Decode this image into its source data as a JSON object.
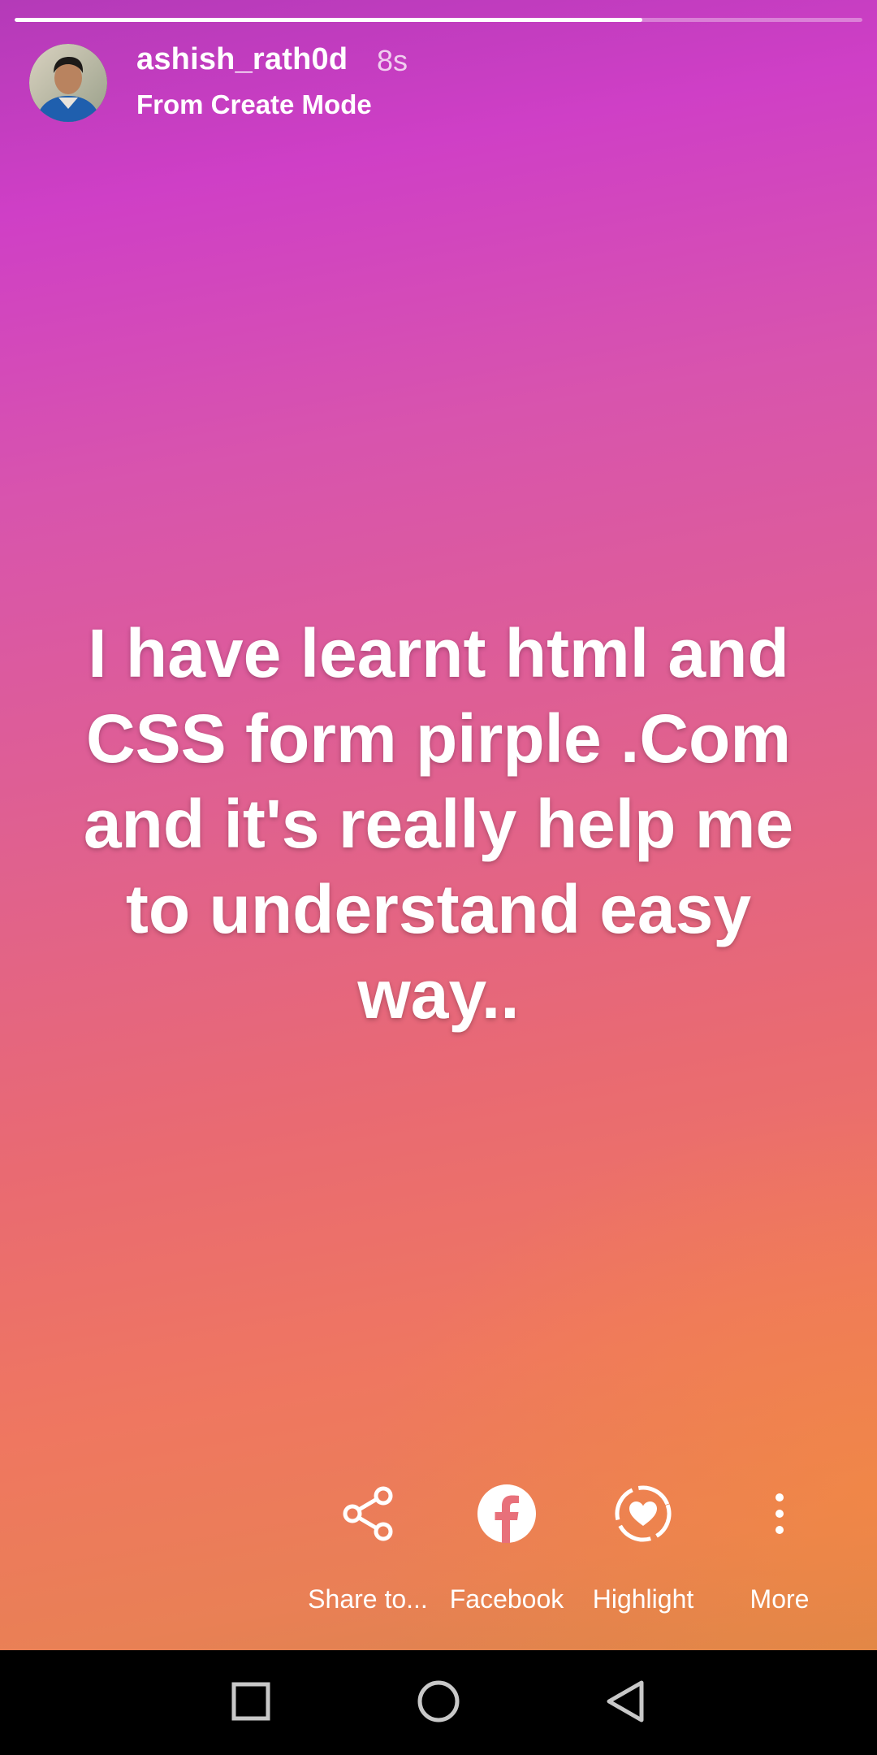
{
  "story": {
    "progress": 0.74,
    "username": "ashish_rath0d",
    "timestamp": "8s",
    "subtitle": "From Create Mode",
    "text": "I have learnt html and CSS form pirple .Com and it's really help me to understand easy way.."
  },
  "actions": {
    "share_label": "Share to...",
    "facebook_label": "Facebook",
    "highlight_label": "Highlight",
    "more_label": "More"
  },
  "icons": {
    "share": "share-icon",
    "facebook": "facebook-icon",
    "highlight": "highlight-heart-icon",
    "more": "more-vertical-icon",
    "nav_recent": "square-recent-apps-icon",
    "nav_home": "circle-home-icon",
    "nav_back": "triangle-back-icon"
  },
  "colors": {
    "gradient_top": "#b43ab8",
    "gradient_mid": "#e0618e",
    "gradient_bottom": "#ef7760",
    "navbar": "#000000"
  }
}
